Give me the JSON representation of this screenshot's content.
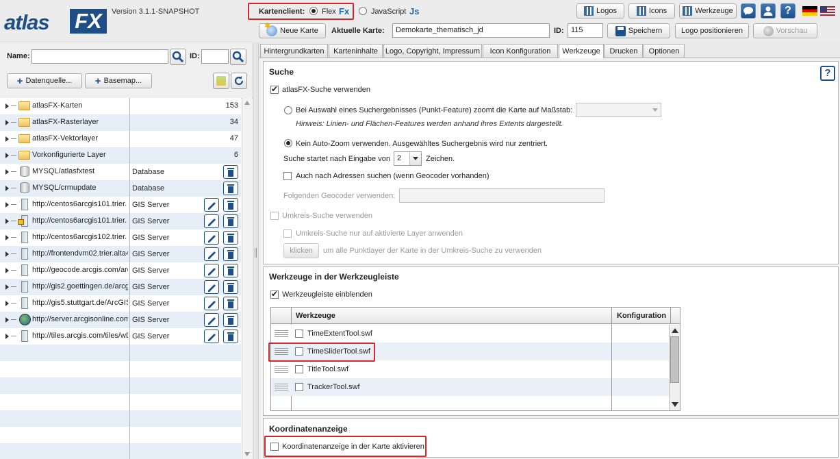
{
  "header": {
    "logo_a": "atlas",
    "logo_b": "FX",
    "version": "Version 3.1.1-SNAPSHOT",
    "client_label": "Kartenclient:",
    "client_flex": "Flex",
    "client_flex_icon": "Fx",
    "client_js": "JavaScript",
    "client_js_icon": "Js",
    "logos_btn": "Logos",
    "icons_btn": "Icons",
    "werkzeuge_btn": "Werkzeuge",
    "new_map_btn": "Neue Karte",
    "current_map_label": "Aktuelle Karte:",
    "current_map_value": "Demokarte_thematisch_jd",
    "id_label": "ID:",
    "id_value": "115",
    "save_btn": "Speichern",
    "logo_pos_btn": "Logo positionieren",
    "preview_btn": "Vorschau"
  },
  "left": {
    "name_label": "Name:",
    "id_label": "ID:",
    "datasource_btn": "Datenquelle...",
    "basemap_btn": "Basemap...",
    "rows": [
      {
        "name": "atlasFX-Karten",
        "count": "153",
        "type": "",
        "icon": "folder-icon"
      },
      {
        "name": "atlasFX-Rasterlayer",
        "count": "34",
        "type": "",
        "icon": "folder-icon"
      },
      {
        "name": "atlasFX-Vektorlayer",
        "count": "47",
        "type": "",
        "icon": "folder-icon"
      },
      {
        "name": "Vorkonfigurierte Layer",
        "count": "6",
        "type": "",
        "icon": "folder-icon"
      },
      {
        "name": "MYSQL/atlasfxtest",
        "count": "",
        "type": "Database",
        "icon": "database-icon"
      },
      {
        "name": "MYSQL/crmupdate",
        "count": "",
        "type": "Database",
        "icon": "database-icon"
      },
      {
        "name": "http://centos6arcgis101.trier.",
        "count": "",
        "type": "GIS Server",
        "icon": "server-icon"
      },
      {
        "name": "http://centos6arcgis101.trier.",
        "count": "",
        "type": "GIS Server",
        "icon": "locked-server-icon"
      },
      {
        "name": "http://centos6arcgis102.trier.",
        "count": "",
        "type": "GIS Server",
        "icon": "server-icon"
      },
      {
        "name": "http://frontendvm02.trier.alta4",
        "count": "",
        "type": "GIS Server",
        "icon": "server-icon"
      },
      {
        "name": "http://geocode.arcgis.com/arc",
        "count": "",
        "type": "GIS Server",
        "icon": "server-icon"
      },
      {
        "name": "http://gis2.goettingen.de/arcg",
        "count": "",
        "type": "GIS Server",
        "icon": "server-icon"
      },
      {
        "name": "http://gis5.stuttgart.de/ArcGIS",
        "count": "",
        "type": "GIS Server",
        "icon": "server-icon"
      },
      {
        "name": "http://server.arcgisonline.com",
        "count": "",
        "type": "GIS Server",
        "icon": "globe-icon"
      },
      {
        "name": "http://tiles.arcgis.com/tiles/wD",
        "count": "",
        "type": "GIS Server",
        "icon": "server-icon"
      }
    ]
  },
  "tabs": [
    "Hintergrundkarten",
    "Karteninhalte",
    "Logo, Copyright, Impressum",
    "Icon Konfiguration",
    "Werkzeuge",
    "Drucken",
    "Optionen"
  ],
  "search": {
    "title": "Suche",
    "enable": "atlasFX-Suche verwenden",
    "zoom_option": "Bei Auswahl eines Suchergebnisses (Punkt-Feature) zoomt die Karte auf Maßstab:",
    "hint": "Hinweis: Linien- und Flächen-Features werden anhand ihres Extents dargestellt.",
    "no_zoom_option": "Kein Auto-Zoom verwenden. Ausgewähltes Suchergebnis wird nur zentriert.",
    "start_label": "Suche startet nach Eingabe von",
    "start_value": "2",
    "start_suffix": "Zeichen.",
    "address": "Auch nach Adressen suchen (wenn Geocoder vorhanden)",
    "geocoder_label": "Folgenden Geocoder verwenden:",
    "radius": "Umkreis-Suche verwenden",
    "radius_active": "Umkreis-Suche nur auf aktivierte Layer anwenden",
    "click_btn": "klicken",
    "click_text": "um alle Punktlayer der Karte in der Umkreis-Suche zu verwenden"
  },
  "tools": {
    "title": "Werkzeuge in der Werkzeugleiste",
    "show": "Werkzeugleiste einblenden",
    "col_tools": "Werkzeuge",
    "col_config": "Konfiguration",
    "items": [
      "TimeExtentTool.swf",
      "TimeSliderTool.swf",
      "TitleTool.swf",
      "TrackerTool.swf"
    ]
  },
  "coords": {
    "title": "Koordinatenanzeige",
    "enable": "Koordinatenanzeige in der Karte aktivieren"
  }
}
